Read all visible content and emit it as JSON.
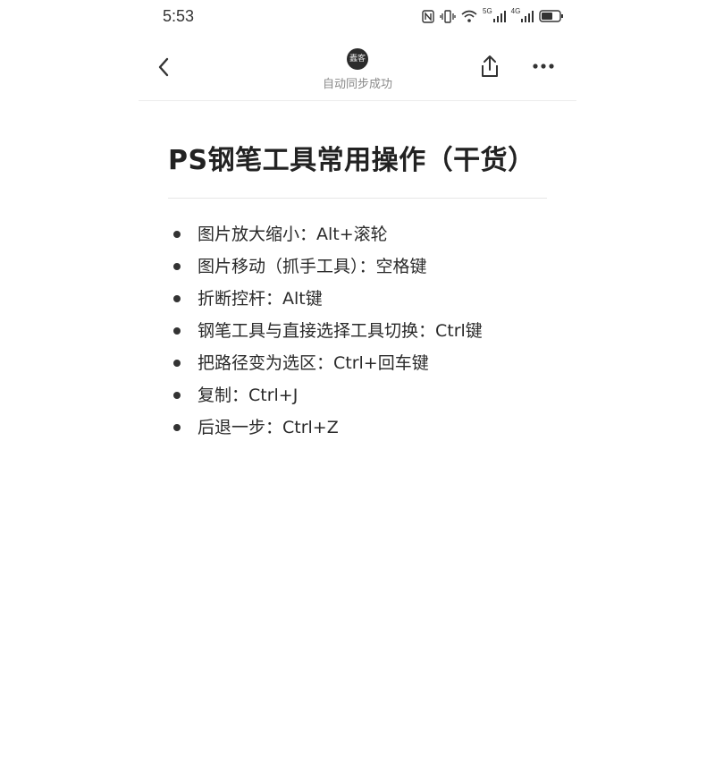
{
  "status_bar": {
    "time": "5:53",
    "network_1": "5G",
    "network_2": "4G",
    "icons": [
      "nfc-icon",
      "vibrate-icon",
      "wifi-icon",
      "signal-icon",
      "signal-icon",
      "battery-icon"
    ]
  },
  "header": {
    "avatar_text": "蠹客",
    "sync_status": "自动同步成功",
    "icons": [
      "chevron-left-icon",
      "share-icon",
      "more-icon"
    ]
  },
  "note": {
    "title": "PS钢笔工具常用操作（干货）",
    "items": [
      "图片放大缩小：Alt+滚轮",
      "图片移动（抓手工具）：空格键",
      "折断控杆：Alt键",
      "钢笔工具与直接选择工具切换：Ctrl键",
      "把路径变为选区：Ctrl+回车键",
      "复制：Ctrl+J",
      "后退一步：Ctrl+Z"
    ]
  },
  "colors": {
    "text": "#222222",
    "muted": "#8a8a8a",
    "divider": "#e6e6e6",
    "background": "#ffffff"
  }
}
